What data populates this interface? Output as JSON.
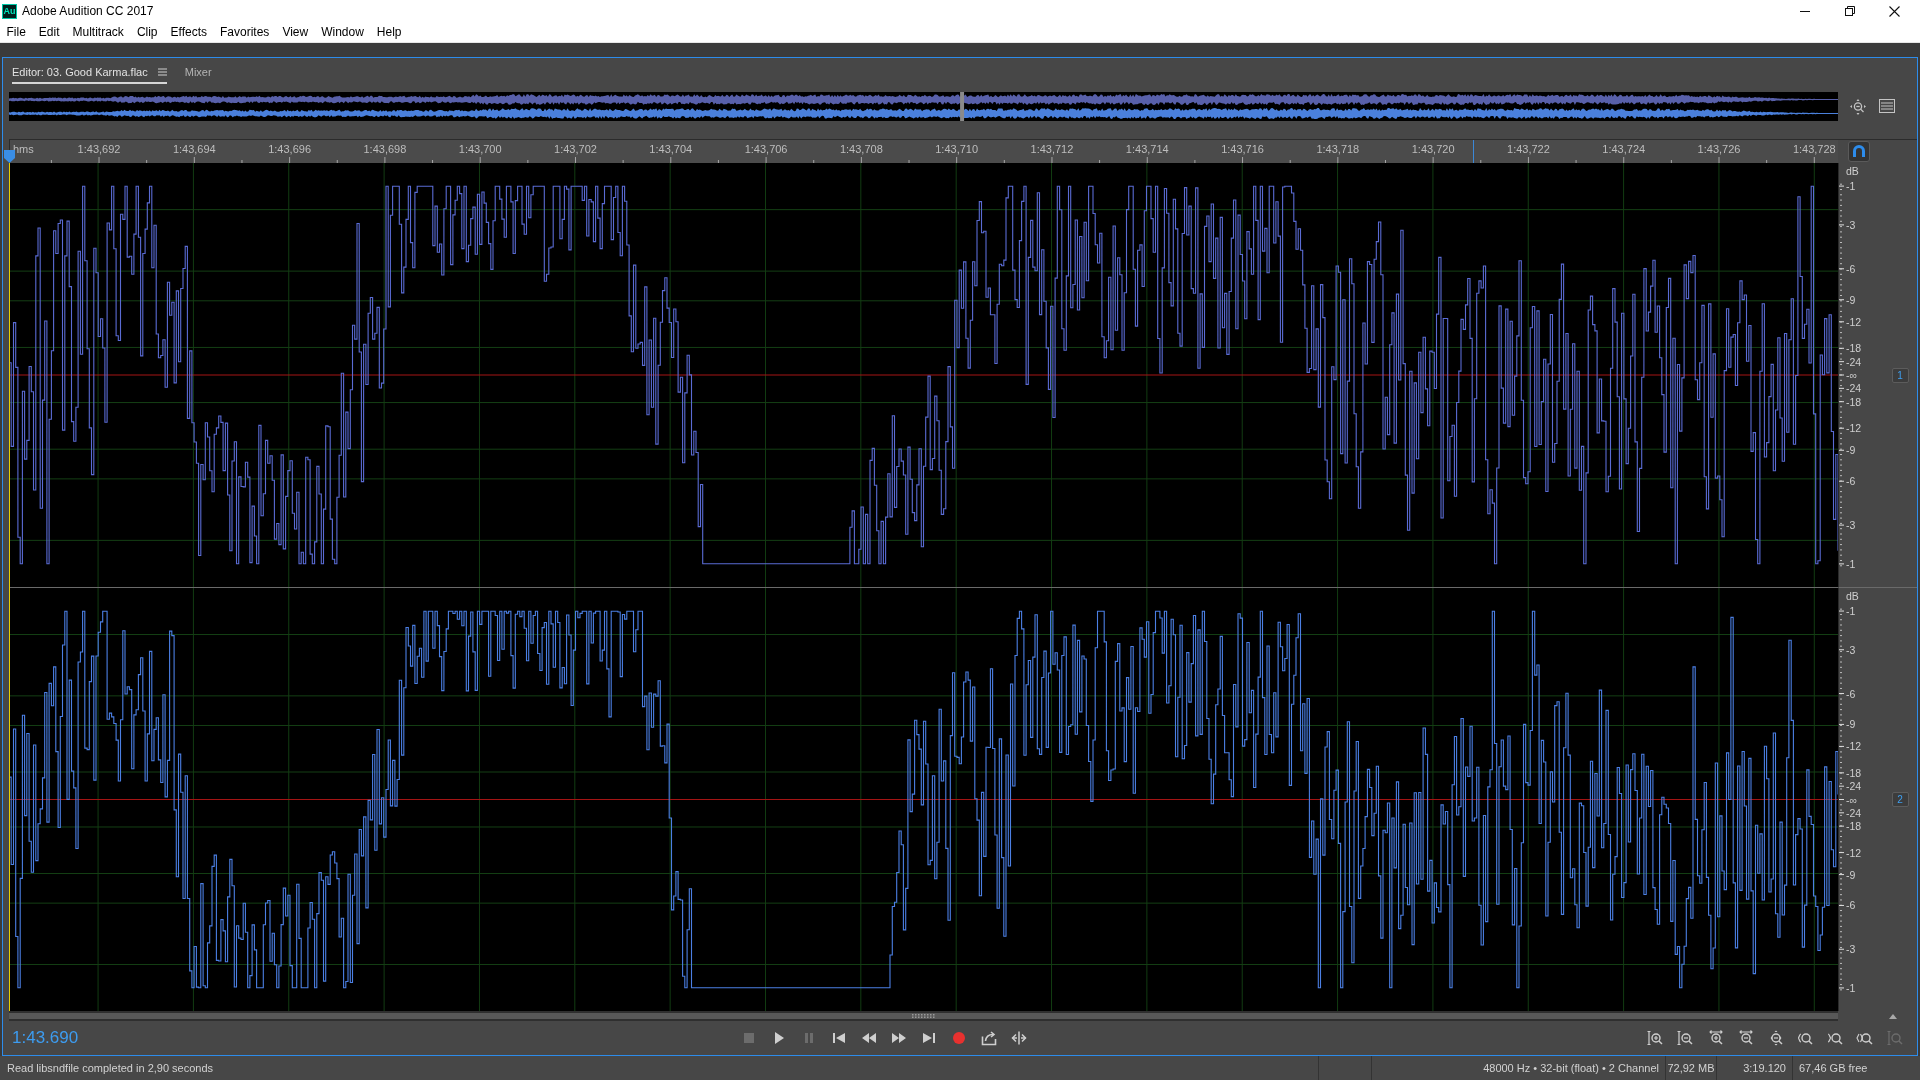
{
  "window": {
    "app_icon": "Au",
    "title": "Adobe Audition CC 2017"
  },
  "menu": [
    "File",
    "Edit",
    "Multitrack",
    "Clip",
    "Effects",
    "Favorites",
    "View",
    "Window",
    "Help"
  ],
  "tabs": [
    {
      "label": "Editor: 03. Good Karma.flac",
      "selected": true
    },
    {
      "label": "Mixer",
      "selected": false
    }
  ],
  "ruler": {
    "unit": "hms",
    "ticks": [
      "1:43,692",
      "1:43,694",
      "1:43,696",
      "1:43,698",
      "1:43,700",
      "1:43,702",
      "1:43,704",
      "1:43,706",
      "1:43,708",
      "1:43,710",
      "1:43,712",
      "1:43,714",
      "1:43,716",
      "1:43,718",
      "1:43,720",
      "1:43,722",
      "1:43,724",
      "1:43,726",
      "1:43,728"
    ],
    "snap_on": true
  },
  "channels": [
    {
      "label": "1",
      "enabled": true,
      "db_unit": "dB",
      "db_ticks": [
        "-1",
        "-3",
        "-6",
        "-9",
        "-12",
        "-18",
        "-24",
        "-∞",
        "-24",
        "-18",
        "-12",
        "-9",
        "-6",
        "-3",
        "-1"
      ]
    },
    {
      "label": "2",
      "enabled": true,
      "db_unit": "dB",
      "db_ticks": [
        "-1",
        "-3",
        "-6",
        "-9",
        "-12",
        "-18",
        "-24",
        "-∞",
        "-24",
        "-18",
        "-12",
        "-9",
        "-6",
        "-3",
        "-1"
      ]
    }
  ],
  "time_display": "1:43.690",
  "transport": [
    {
      "kind": "stop",
      "disabled": true
    },
    {
      "kind": "play",
      "disabled": false
    },
    {
      "kind": "pause",
      "disabled": true
    },
    {
      "kind": "previous",
      "disabled": false
    },
    {
      "kind": "rewind",
      "disabled": false
    },
    {
      "kind": "forward",
      "disabled": false
    },
    {
      "kind": "next",
      "disabled": false
    },
    {
      "kind": "record",
      "disabled": false
    },
    {
      "kind": "loop",
      "disabled": false
    },
    {
      "kind": "skip",
      "disabled": false
    }
  ],
  "zoom_controls": [
    {
      "kind": "amp_in",
      "disabled": false
    },
    {
      "kind": "amp_out",
      "disabled": false
    },
    {
      "kind": "time_in",
      "disabled": false
    },
    {
      "kind": "time_out",
      "disabled": false
    },
    {
      "kind": "full",
      "disabled": false
    },
    {
      "kind": "in_point",
      "disabled": false
    },
    {
      "kind": "out_point",
      "disabled": false
    },
    {
      "kind": "selection",
      "disabled": false
    },
    {
      "kind": "track",
      "disabled": true
    }
  ],
  "status_bar": {
    "message": "Read libsndfile completed in 2,90 seconds",
    "format": "48000 Hz • 32-bit (float) • 2 Channel",
    "size": "72,92 MB",
    "duration": "3:19.120",
    "free_space": "67,46 GB free"
  }
}
